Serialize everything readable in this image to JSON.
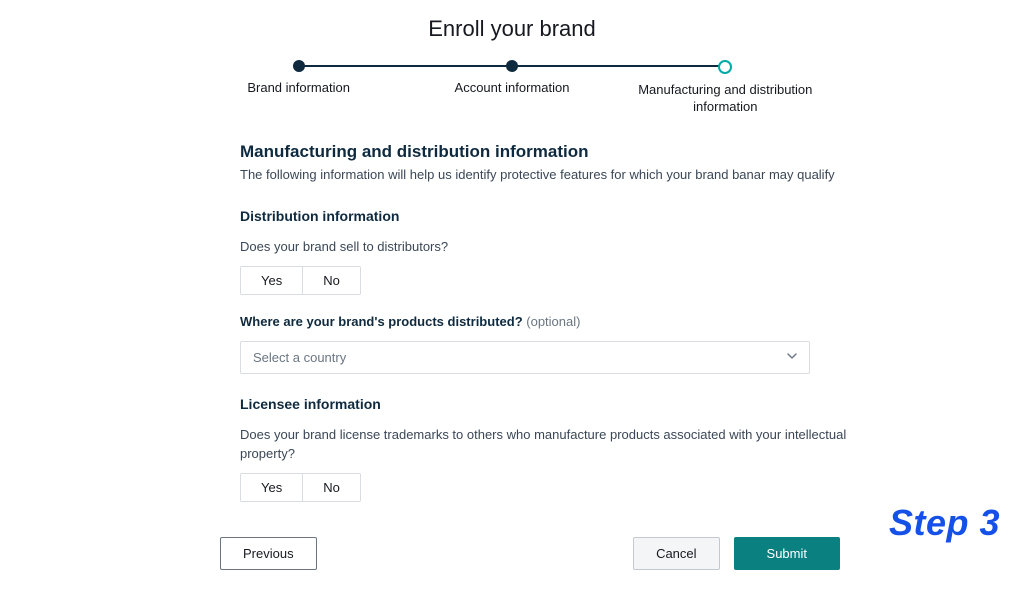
{
  "page_title": "Enroll your brand",
  "stepper": {
    "steps": [
      {
        "label": "Brand information"
      },
      {
        "label": "Account information"
      },
      {
        "label": "Manufacturing and distribution information"
      }
    ],
    "active_index": 2
  },
  "section": {
    "title": "Manufacturing and distribution information",
    "description": "The following information will help us identify protective features for which your brand banar may qualify"
  },
  "distribution": {
    "group_title": "Distribution information",
    "q1": "Does your brand sell to distributors?",
    "yes": "Yes",
    "no": "No",
    "q2_label": "Where are your brand's products distributed?",
    "q2_optional": "(optional)",
    "select_placeholder": "Select a country"
  },
  "licensee": {
    "group_title": "Licensee information",
    "q1": "Does your brand license trademarks to others who manufacture products associated with your intellectual property?",
    "yes": "Yes",
    "no": "No"
  },
  "footer": {
    "previous": "Previous",
    "cancel": "Cancel",
    "submit": "Submit"
  },
  "overlay": {
    "step_label": "Step 3"
  },
  "colors": {
    "primary_teal": "#0B8080",
    "step_active_ring": "#00A8A8",
    "text_dark": "#0F2A3E",
    "overlay_blue": "#1551E8"
  }
}
